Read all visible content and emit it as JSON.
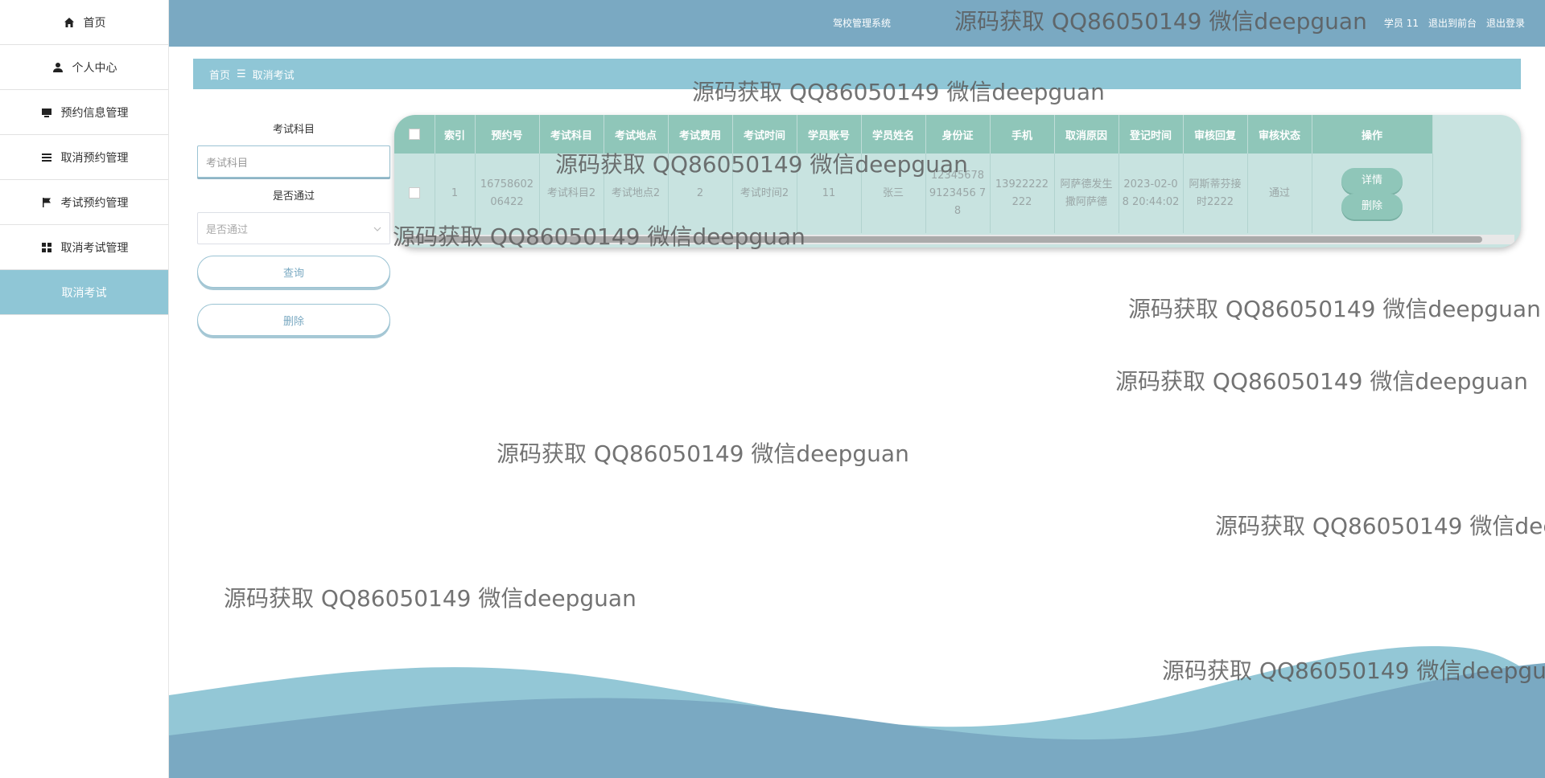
{
  "sidebar": {
    "items": [
      {
        "label": "首页",
        "icon": "home-icon"
      },
      {
        "label": "个人中心",
        "icon": "user-icon"
      },
      {
        "label": "预约信息管理",
        "icon": "monitor-icon"
      },
      {
        "label": "取消预约管理",
        "icon": "list-icon"
      },
      {
        "label": "考试预约管理",
        "icon": "flag-icon"
      },
      {
        "label": "取消考试管理",
        "icon": "grid-icon"
      }
    ],
    "sub_item": "取消考试"
  },
  "header": {
    "system_title": "驾校管理系统",
    "user": "学员 11",
    "back_front": "退出到前台",
    "logout": "退出登录"
  },
  "breadcrumb": {
    "home": "首页",
    "sep": "☰",
    "current": "取消考试"
  },
  "search": {
    "subject_label": "考试科目",
    "subject_placeholder": "考试科目",
    "pass_label": "是否通过",
    "pass_placeholder": "是否通过",
    "query_button": "查询",
    "delete_button": "删除"
  },
  "table": {
    "headers": [
      "索引",
      "预约号",
      "考试科目",
      "考试地点",
      "考试费用",
      "考试时间",
      "学员账号",
      "学员姓名",
      "身份证",
      "手机",
      "取消原因",
      "登记时间",
      "审核回复",
      "审核状态",
      "操作"
    ],
    "rows": [
      [
        "1",
        "1675860206422",
        "考试科目2",
        "考试地点2",
        "2",
        "考试时间2",
        "11",
        "张三",
        "123456789123456 78",
        "13922222222",
        "阿萨德发生撒阿萨德",
        "2023-02-08 20:44:02",
        "阿斯蒂芬接时2222",
        "通过"
      ]
    ],
    "detail_button": "详情",
    "delete_button": "删除"
  },
  "watermark": "源码获取 QQ86050149 微信deepguan",
  "colors": {
    "header": "#7aa9c2",
    "breadcrumb": "#8fc6d6",
    "table_header": "#8fc6b9",
    "table_body": "#c8e3e0"
  }
}
